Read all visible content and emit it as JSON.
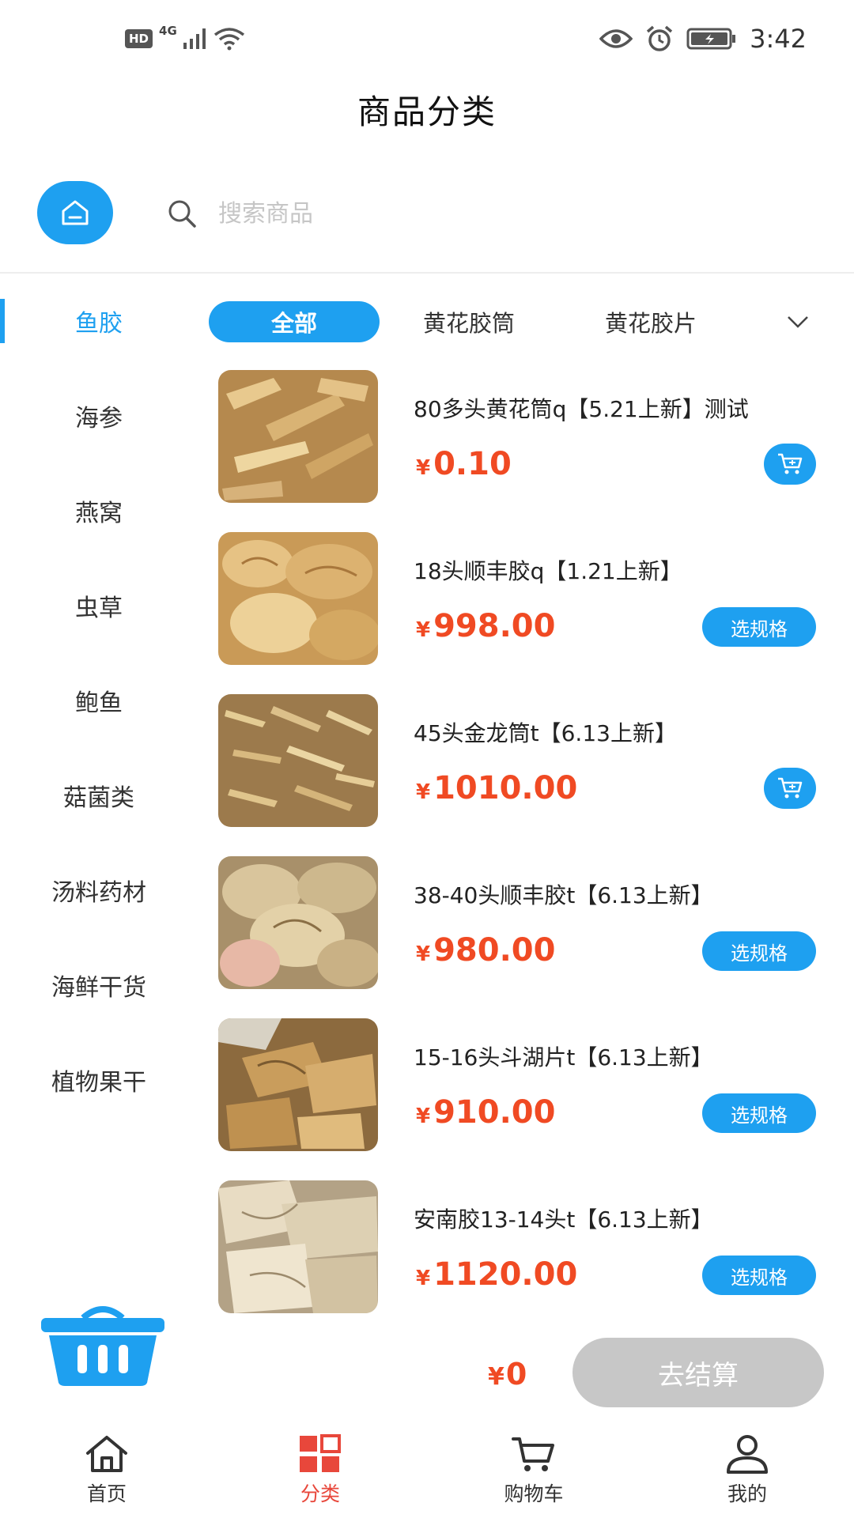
{
  "status_bar": {
    "hd": "HD",
    "network": "4G",
    "time": "3:42"
  },
  "header": {
    "title": "商品分类"
  },
  "search": {
    "placeholder": "搜索商品"
  },
  "categories": [
    {
      "label": "鱼胶",
      "active": true
    },
    {
      "label": "海参"
    },
    {
      "label": "燕窝"
    },
    {
      "label": "虫草"
    },
    {
      "label": "鲍鱼"
    },
    {
      "label": "菇菌类"
    },
    {
      "label": "汤料药材"
    },
    {
      "label": "海鲜干货"
    },
    {
      "label": "植物果干"
    }
  ],
  "subtabs": [
    {
      "label": "全部",
      "active": true
    },
    {
      "label": "黄花胶筒"
    },
    {
      "label": "黄花胶片"
    }
  ],
  "currency": "¥",
  "products": [
    {
      "name": "80多头黄花筒q【5.21上新】测试",
      "price": "0.10",
      "action": "cart"
    },
    {
      "name": "18头顺丰胶q【1.21上新】",
      "price": "998.00",
      "action": "spec",
      "action_label": "选规格"
    },
    {
      "name": "45头金龙筒t【6.13上新】",
      "price": "1010.00",
      "action": "cart"
    },
    {
      "name": "38-40头顺丰胶t【6.13上新】",
      "price": "980.00",
      "action": "spec",
      "action_label": "选规格"
    },
    {
      "name": "15-16头斗湖片t【6.13上新】",
      "price": "910.00",
      "action": "spec",
      "action_label": "选规格"
    },
    {
      "name": "安南胶13-14头t【6.13上新】",
      "price": "1120.00",
      "action": "spec",
      "action_label": "选规格"
    }
  ],
  "checkout": {
    "total": "0",
    "button_label": "去结算"
  },
  "bottom_nav": [
    {
      "label": "首页",
      "icon": "home-icon"
    },
    {
      "label": "分类",
      "icon": "category-grid-icon",
      "active": true
    },
    {
      "label": "购物车",
      "icon": "cart-icon"
    },
    {
      "label": "我的",
      "icon": "user-icon"
    }
  ],
  "colors": {
    "accent": "#1ea0f0",
    "price": "#f04a23",
    "nav_active": "#e8473b",
    "checkout_disabled": "#c7c7c7"
  }
}
